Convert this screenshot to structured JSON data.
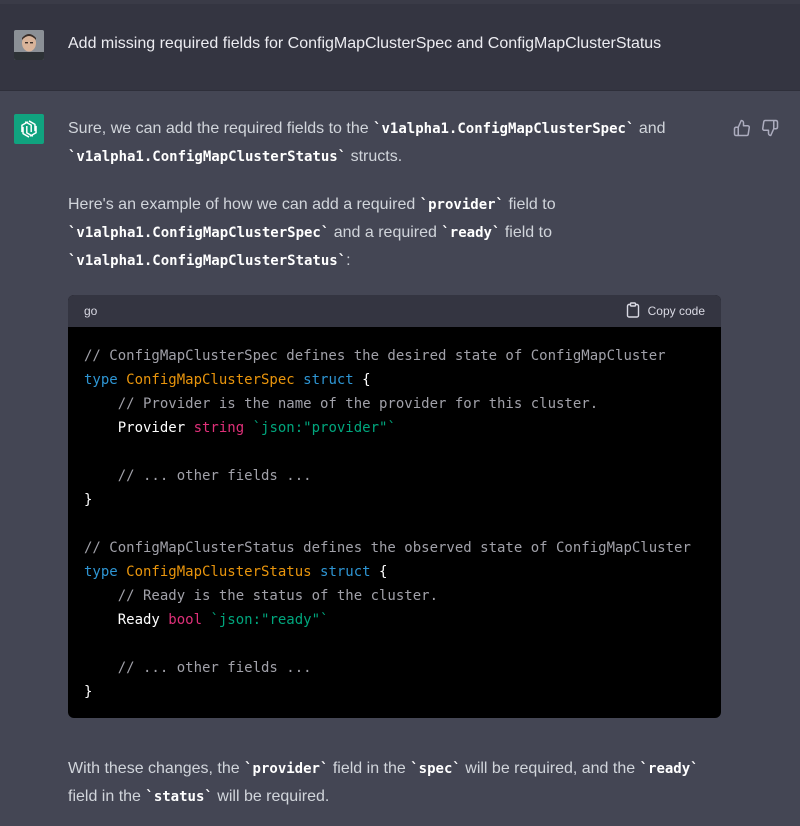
{
  "user_message": "Add missing required fields for ConfigMapClusterSpec and ConfigMapClusterStatus",
  "response": {
    "p1": {
      "a": "Sure, we can add the required fields to the ",
      "c1": "`v1alpha1.ConfigMapClusterSpec`",
      "b": " and",
      "c2": "`v1alpha1.ConfigMapClusterStatus`",
      "d": " structs."
    },
    "p2": {
      "a": "Here's an example of how we can add a required ",
      "c1": "`provider`",
      "b": " field to",
      "c2": "`v1alpha1.ConfigMapClusterSpec`",
      "d": " and a required ",
      "c3": "`ready`",
      "e": " field to",
      "c4": "`v1alpha1.ConfigMapClusterStatus`",
      "f": ":"
    },
    "code_block": {
      "language": "go",
      "copy_label": "Copy code",
      "lines": {
        "l1": "// ConfigMapClusterSpec defines the desired state of ConfigMapCluster",
        "l2_kw": "type",
        "l2_name": " ConfigMapClusterSpec ",
        "l2_kw2": "struct",
        "l2_end": " {",
        "l3": "    // Provider is the name of the provider for this cluster.",
        "l4_field": "    Provider ",
        "l4_type": "string",
        "l4_tag": " `json:\"provider\"`",
        "l6": "    // ... other fields ...",
        "l7": "}",
        "l9": "// ConfigMapClusterStatus defines the observed state of ConfigMapCluster",
        "l10_kw": "type",
        "l10_name": " ConfigMapClusterStatus ",
        "l10_kw2": "struct",
        "l10_end": " {",
        "l11": "    // Ready is the status of the cluster.",
        "l12_field": "    Ready ",
        "l12_type": "bool",
        "l12_tag": " `json:\"ready\"`",
        "l14": "    // ... other fields ...",
        "l15": "}"
      }
    },
    "p3": {
      "a": "With these changes, the ",
      "c1": "`provider`",
      "b": " field in the ",
      "c2": "`spec`",
      "c": " will be required, and the ",
      "c3": "`ready`",
      "d": "field in the ",
      "c4": "`status`",
      "e": " will be required."
    }
  },
  "icons": {
    "user_avatar": "user-avatar-photo",
    "assistant_avatar": "openai-logo-icon",
    "like": "thumbs-up-icon",
    "dislike": "thumbs-down-icon",
    "copy": "clipboard-icon"
  },
  "colors": {
    "accent": "#10a37f",
    "background_user": "#343541",
    "background_assistant": "#444654",
    "code_background": "#000000"
  }
}
